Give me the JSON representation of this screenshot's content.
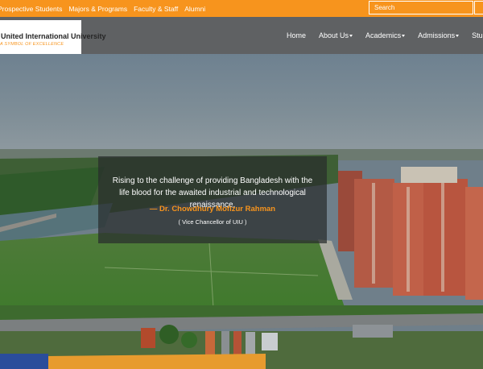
{
  "topbar": {
    "links": [
      "Prospective Students",
      "Majors & Programs",
      "Faculty & Staff",
      "Alumni"
    ],
    "search_placeholder": "Search",
    "color": "#f7941d"
  },
  "header": {
    "logo_name": "United International University",
    "logo_tagline": "A SYMBOL OF EXCELLENCE",
    "nav": [
      {
        "label": "Home"
      },
      {
        "label": "About Us",
        "dropdown": true
      },
      {
        "label": "Academics",
        "dropdown": true
      },
      {
        "label": "Admissions",
        "dropdown": true
      },
      {
        "label": "Students",
        "dropdown": true
      }
    ]
  },
  "hero": {
    "quote_text": "Rising to the challenge of providing Bangladesh with the life blood for the awaited industrial and technological renaissance.",
    "quote_author": "— Dr. Chowdhury Mofizur Rahman",
    "quote_role": "( Vice Chancellor of UIU )"
  }
}
